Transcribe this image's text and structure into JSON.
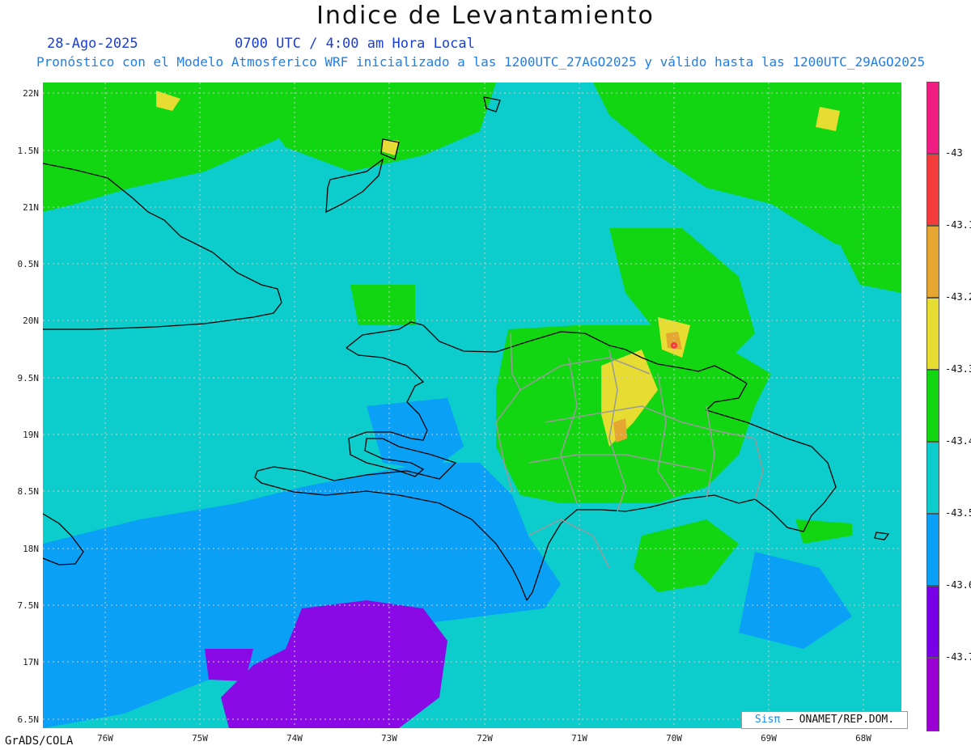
{
  "header": {
    "title": "Indice de Levantamiento",
    "date": "28-Ago-2025",
    "time": "0700 UTC / 4:00 am Hora Local",
    "subtitle": "Pronóstico con el Modelo Atmosferico WRF inicializado a las 1200UTC_27AGO2025 y válido hasta las  1200UTC_29AGO2025"
  },
  "map": {
    "lat_labels": [
      "22N",
      "1.5N",
      "21N",
      "0.5N",
      "20N",
      "9.5N",
      "19N",
      "8.5N",
      "18N",
      "7.5N",
      "17N",
      "6.5N"
    ],
    "lon_labels": [
      "76W",
      "75W",
      "74W",
      "73W",
      "72W",
      "71W",
      "70W",
      "69W",
      "68W"
    ],
    "field_colors": {
      "green": "#11d611",
      "cyan": "#0ccccc",
      "blue": "#0aa0f5",
      "purple": "#8a0ae6",
      "yellow": "#e6dc32",
      "orange": "#e6a632",
      "red": "#f53c3c"
    }
  },
  "legend": {
    "labels": [
      "-43",
      "-43.1",
      "-43.2",
      "-43.3",
      "-43.4",
      "-43.5",
      "-43.6",
      "-43.7"
    ],
    "colors": [
      "#f01e82",
      "#f53c3c",
      "#e6a632",
      "#e6dc32",
      "#11d611",
      "#0ccccc",
      "#0aa0f5",
      "#7800e6",
      "#9a00d2"
    ]
  },
  "footer": {
    "credit": "GrADS/COLA",
    "brand_prefix": "Sisπ",
    "brand_text": " – ONAMET/REP.DOM."
  }
}
